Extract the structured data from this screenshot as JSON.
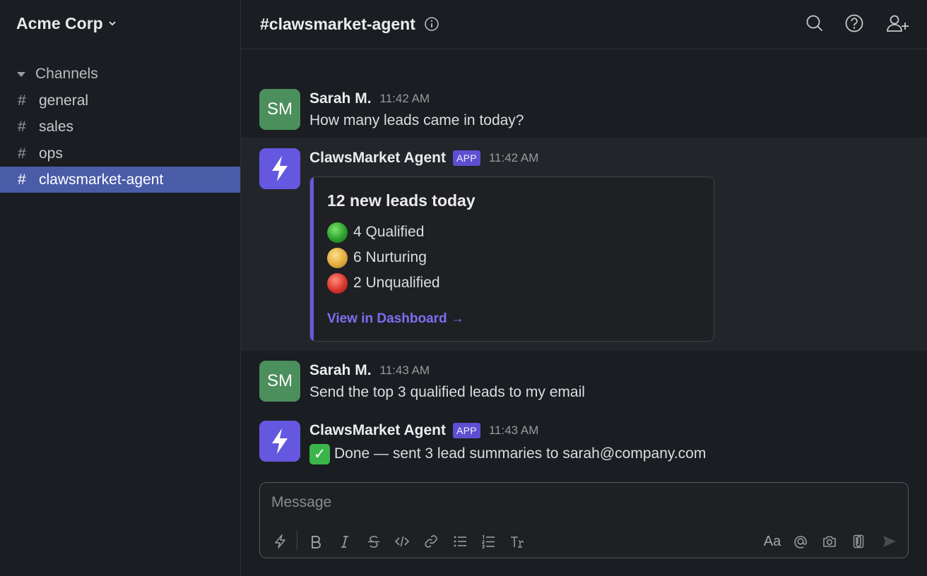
{
  "workspace": {
    "name": "Acme Corp"
  },
  "sidebar": {
    "section_label": "Channels",
    "channels": [
      {
        "name": "general"
      },
      {
        "name": "sales"
      },
      {
        "name": "ops"
      },
      {
        "name": "clawsmarket-agent",
        "active": true
      }
    ]
  },
  "header": {
    "title": "#clawsmarket-agent"
  },
  "messages": [
    {
      "initials": "SM",
      "sender": "Sarah M.",
      "time": "11:42 AM",
      "text": "How many leads came in today?"
    },
    {
      "sender": "ClawsMarket Agent",
      "badge": "APP",
      "time": "11:42 AM",
      "card": {
        "title": "12 new leads today",
        "rows": [
          {
            "color": "green",
            "text": "4 Qualified"
          },
          {
            "color": "yellow",
            "text": "6 Nurturing"
          },
          {
            "color": "red",
            "text": "2 Unqualified"
          }
        ],
        "link": "View in Dashboard →"
      }
    },
    {
      "initials": "SM",
      "sender": "Sarah M.",
      "time": "11:43 AM",
      "text": "Send the top 3 qualified leads to my email"
    },
    {
      "sender": "ClawsMarket Agent",
      "badge": "APP",
      "time": "11:43 AM",
      "text": "Done — sent 3 lead summaries to sarah@company.com",
      "check": "✓"
    }
  ],
  "composer": {
    "placeholder": "Message",
    "value": "",
    "text_style_label": "Aa"
  },
  "colors": {
    "accent": "#6558e0",
    "active_channel": "#4a5ca8",
    "user_avatar": "#4b8f5d",
    "link": "#7c6ff0"
  }
}
